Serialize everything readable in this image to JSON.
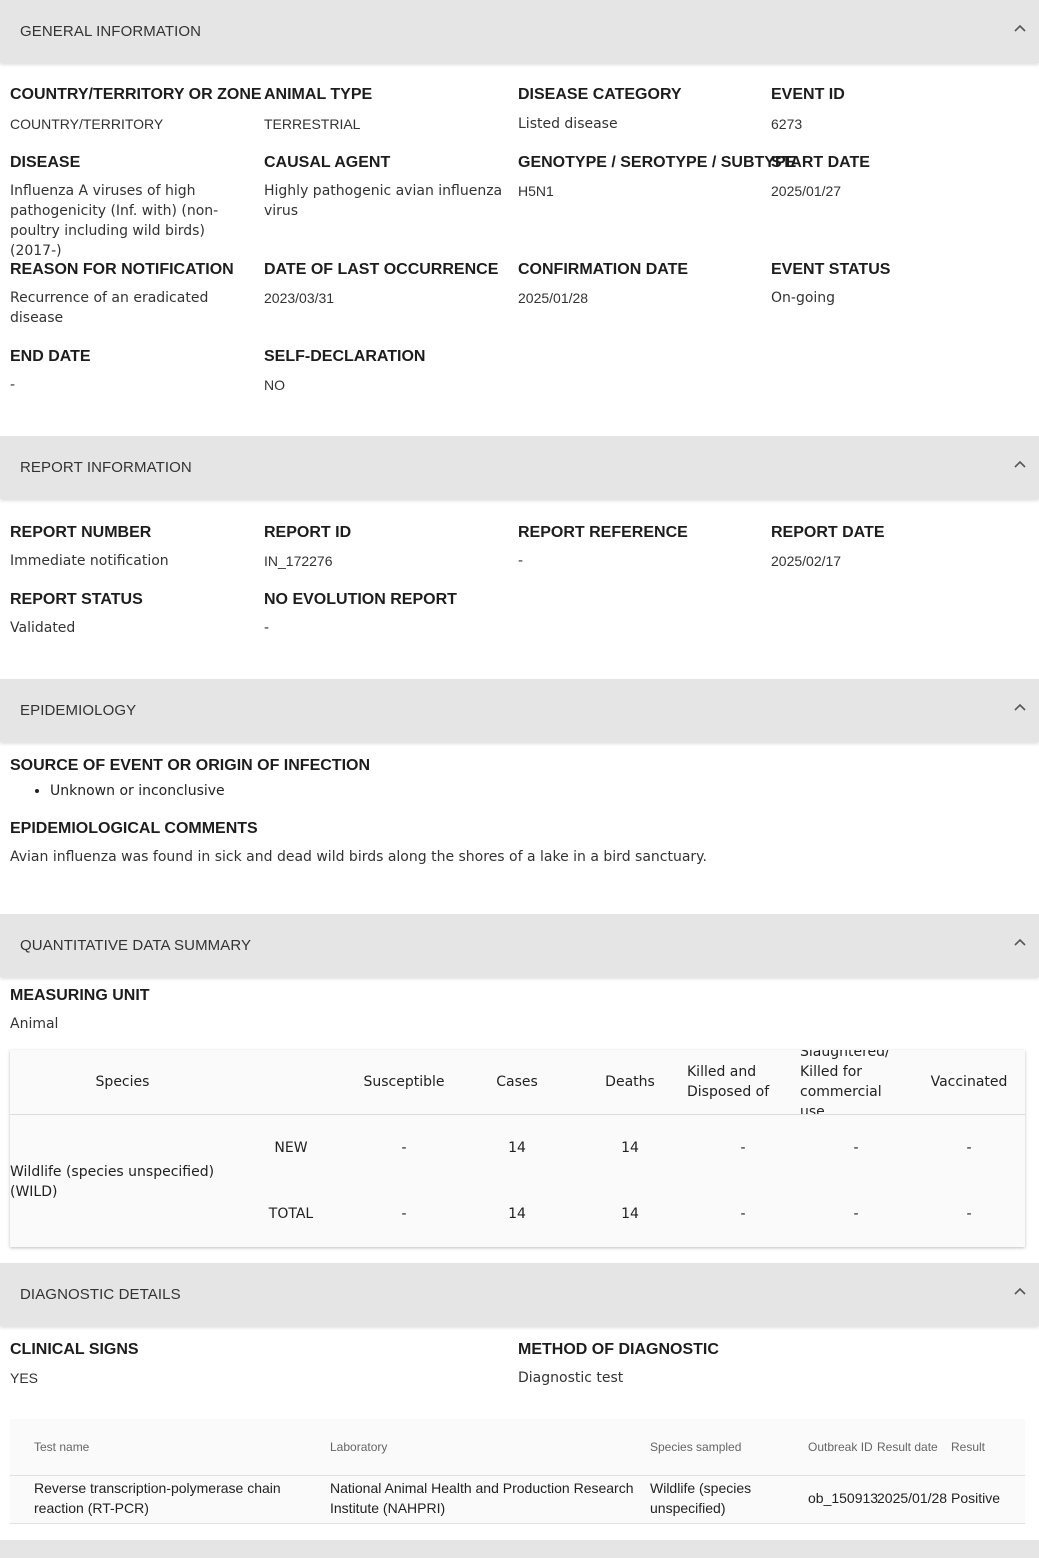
{
  "sections": {
    "general": "GENERAL INFORMATION",
    "report": "REPORT INFORMATION",
    "epi": "EPIDEMIOLOGY",
    "quant": "QUANTITATIVE DATA SUMMARY",
    "diag": "DIAGNOSTIC DETAILS"
  },
  "general": {
    "country_label": "COUNTRY/TERRITORY OR ZONE",
    "country_value": "COUNTRY/TERRITORY",
    "animal_label": "ANIMAL TYPE",
    "animal_value": "TERRESTRIAL",
    "category_label": "DISEASE CATEGORY",
    "category_value": "Listed disease",
    "event_label": "EVENT ID",
    "event_value": "6273",
    "disease_label": "DISEASE",
    "disease_value": "Influenza A viruses of high pathogenicity (Inf. with) (non-poultry including wild birds) (2017-)",
    "agent_label": "CAUSAL AGENT",
    "agent_value": "Highly pathogenic avian influenza virus",
    "genotype_label": "GENOTYPE / SEROTYPE / SUBTYPE",
    "genotype_value": "H5N1",
    "start_label": "START DATE",
    "start_value": "2025/01/27",
    "reason_label": "REASON FOR NOTIFICATION",
    "reason_value": "Recurrence of an eradicated disease",
    "lastocc_label": "DATE OF LAST OCCURRENCE",
    "lastocc_value": "2023/03/31",
    "confirm_label": "CONFIRMATION DATE",
    "confirm_value": "2025/01/28",
    "status_label": "EVENT STATUS",
    "status_value": "On-going",
    "end_label": "END DATE",
    "end_value": "-",
    "selfdecl_label": "SELF-DECLARATION",
    "selfdecl_value": "NO"
  },
  "report": {
    "number_label": "REPORT NUMBER",
    "number_value": "Immediate notification",
    "id_label": "REPORT ID",
    "id_value": "IN_172276",
    "ref_label": "REPORT REFERENCE",
    "ref_value": "-",
    "date_label": "REPORT DATE",
    "date_value": "2025/02/17",
    "status_label": "REPORT STATUS",
    "status_value": "Validated",
    "noevo_label": "NO EVOLUTION REPORT",
    "noevo_value": "-"
  },
  "epi": {
    "source_label": "SOURCE OF EVENT OR ORIGIN OF INFECTION",
    "source_item": "Unknown or inconclusive",
    "comments_label": "EPIDEMIOLOGICAL COMMENTS",
    "comments_value": "Avian influenza was found in sick and dead wild birds along the shores of a lake in a bird sanctuary."
  },
  "quant": {
    "unit_label": "MEASURING UNIT",
    "unit_value": "Animal",
    "headers": {
      "species": "Species",
      "susceptible": "Susceptible",
      "cases": "Cases",
      "deaths": "Deaths",
      "killed": "Killed and Disposed of",
      "slaughtered": "Slaughtered/ Killed for commercial use",
      "vaccinated": "Vaccinated"
    },
    "species_name": "Wildlife (species unspecified) (WILD)",
    "rows": [
      {
        "type": "NEW",
        "susceptible": "-",
        "cases": "14",
        "deaths": "14",
        "killed": "-",
        "slaughtered": "-",
        "vaccinated": "-"
      },
      {
        "type": "TOTAL",
        "susceptible": "-",
        "cases": "14",
        "deaths": "14",
        "killed": "-",
        "slaughtered": "-",
        "vaccinated": "-"
      }
    ]
  },
  "diag": {
    "clinical_label": "CLINICAL SIGNS",
    "clinical_value": "YES",
    "method_label": "METHOD OF DIAGNOSTIC",
    "method_value": "Diagnostic test",
    "table_headers": {
      "test": "Test name",
      "lab": "Laboratory",
      "species": "Species sampled",
      "outbreak": "Outbreak ID",
      "result_date": "Result date",
      "result": "Result"
    },
    "table_row": {
      "test": "Reverse transcription-polymerase chain reaction (RT-PCR)",
      "lab": "National Animal Health and Production Research Institute (NAHPRI)",
      "species": "Wildlife (species unspecified)",
      "outbreak": "ob_150913",
      "result_date": "2025/01/28",
      "result": "Positive"
    }
  }
}
